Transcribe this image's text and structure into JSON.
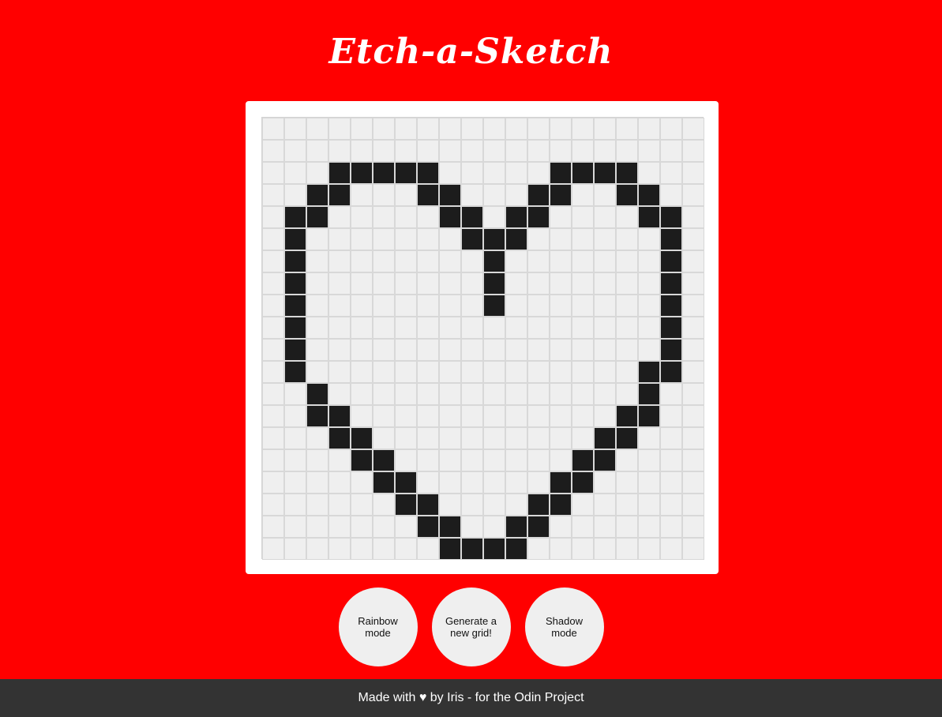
{
  "title": "Etch-a-Sketch",
  "grid": {
    "size": 20,
    "cell_color": "#efefef",
    "ink_color": "#1c1c1c",
    "filled_cells": [
      [
        3,
        3
      ],
      [
        3,
        4
      ],
      [
        3,
        5
      ],
      [
        3,
        6
      ],
      [
        3,
        7
      ],
      [
        3,
        13
      ],
      [
        3,
        14
      ],
      [
        3,
        15
      ],
      [
        3,
        16
      ],
      [
        4,
        2
      ],
      [
        4,
        3
      ],
      [
        4,
        7
      ],
      [
        4,
        8
      ],
      [
        4,
        12
      ],
      [
        4,
        13
      ],
      [
        4,
        16
      ],
      [
        4,
        17
      ],
      [
        5,
        1
      ],
      [
        5,
        2
      ],
      [
        5,
        8
      ],
      [
        5,
        9
      ],
      [
        5,
        11
      ],
      [
        5,
        12
      ],
      [
        5,
        17
      ],
      [
        5,
        18
      ],
      [
        6,
        1
      ],
      [
        6,
        9
      ],
      [
        6,
        10
      ],
      [
        6,
        11
      ],
      [
        6,
        18
      ],
      [
        7,
        1
      ],
      [
        7,
        10
      ],
      [
        7,
        18
      ],
      [
        8,
        1
      ],
      [
        8,
        10
      ],
      [
        8,
        18
      ],
      [
        9,
        1
      ],
      [
        9,
        10
      ],
      [
        9,
        18
      ],
      [
        10,
        1
      ],
      [
        10,
        18
      ],
      [
        11,
        1
      ],
      [
        11,
        18
      ],
      [
        12,
        1
      ],
      [
        12,
        17
      ],
      [
        12,
        18
      ],
      [
        13,
        2
      ],
      [
        13,
        17
      ],
      [
        14,
        2
      ],
      [
        14,
        3
      ],
      [
        14,
        16
      ],
      [
        14,
        17
      ],
      [
        15,
        3
      ],
      [
        15,
        4
      ],
      [
        15,
        15
      ],
      [
        15,
        16
      ],
      [
        16,
        4
      ],
      [
        16,
        5
      ],
      [
        16,
        14
      ],
      [
        16,
        15
      ],
      [
        17,
        5
      ],
      [
        17,
        6
      ],
      [
        17,
        13
      ],
      [
        17,
        14
      ],
      [
        18,
        6
      ],
      [
        18,
        7
      ],
      [
        18,
        12
      ],
      [
        18,
        13
      ],
      [
        19,
        7
      ],
      [
        19,
        8
      ],
      [
        19,
        11
      ],
      [
        19,
        12
      ],
      [
        20,
        8
      ],
      [
        20,
        9
      ],
      [
        20,
        10
      ],
      [
        20,
        11
      ]
    ]
  },
  "buttons": {
    "rainbow": "Rainbow mode",
    "generate": "Generate a new grid!",
    "shadow": "Shadow mode"
  },
  "footer": {
    "text": "Made with ♥ by Iris - for the Odin Project"
  },
  "colors": {
    "background": "#ff0000",
    "footer_bg": "#333333"
  }
}
